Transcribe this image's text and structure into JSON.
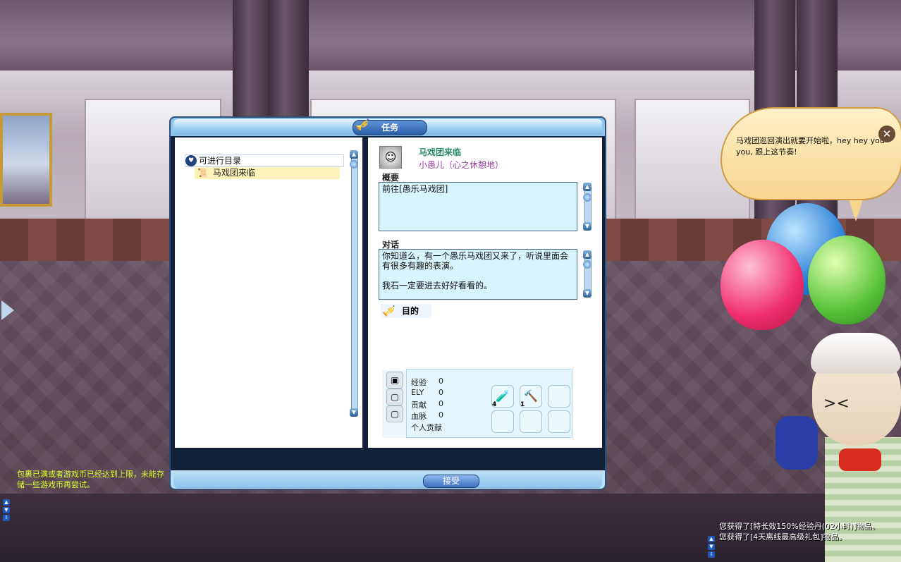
{
  "quest_window": {
    "title": "任务",
    "category_label": "可进行目录",
    "quest_item_label": "马戏团来临",
    "accept_label": "接受"
  },
  "quest_detail": {
    "quest_name": "马戏团来临",
    "npc_name": "小愚儿（心之休憩地）",
    "summary_heading": "概要",
    "summary_text": "前往[愚乐马戏团]",
    "dialog_heading": "对话",
    "dialog_text": "你知道么，有一个愚乐马戏团又来了，听说里面会有很多有趣的表演。\n\n我石一定要进去好好看看的。",
    "goal_label": "目的"
  },
  "rewards": {
    "rows": [
      {
        "label": "经验",
        "value": "0"
      },
      {
        "label": "ELY",
        "value": "0"
      },
      {
        "label": "贡献",
        "value": "0"
      },
      {
        "label": "血脉",
        "value": "0"
      },
      {
        "label": "个人贡献",
        "value": ""
      }
    ],
    "items": [
      {
        "icon": "potion-icon",
        "count": "4"
      },
      {
        "icon": "hammer-icon",
        "count": "1"
      }
    ]
  },
  "npc_bubble": {
    "text": "马戏团巡回演出就要开始啦，hey hey you you, 跟上这节奏!"
  },
  "chat": {
    "system_left": "包裹已满或者游戏币已经达到上限，未能存储一些游戏币再尝试。",
    "log": [
      "您获得了[特长效150%经验丹(02小时)]物品。",
      "您获得了[4天离线最高级礼包]物品。"
    ]
  },
  "colors": {
    "quest_name": "#2a8a6a",
    "npc_name": "#9c3fa4",
    "system_chat": "#d8ff2a"
  }
}
